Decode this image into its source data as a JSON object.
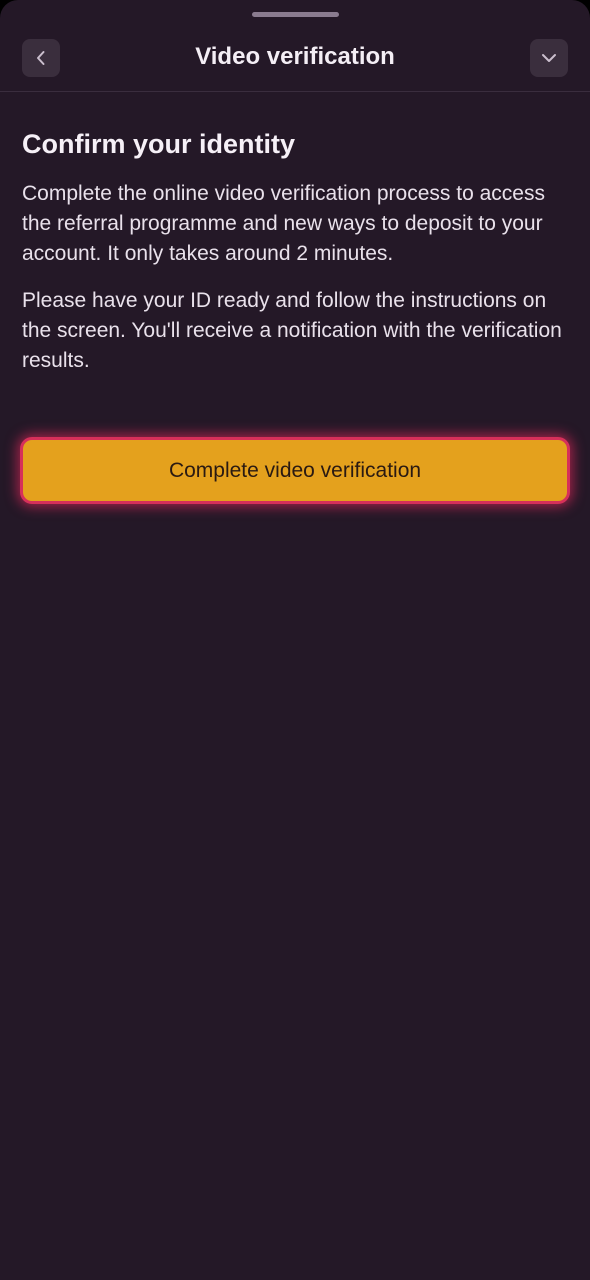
{
  "header": {
    "title": "Video verification",
    "back_icon": "chevron-left-icon",
    "collapse_icon": "chevron-down-icon"
  },
  "main": {
    "heading": "Confirm your identity",
    "paragraph_1": "Complete the online video verification process to access the referral programme and new ways to deposit to your account. It only takes around 2 minutes.",
    "paragraph_2": "Please have your ID ready and follow the instructions on the screen. You'll receive a notification with the verification results.",
    "cta_label": "Complete video verification"
  },
  "colors": {
    "background": "#241827",
    "accent_button": "#e4a11d",
    "focus_ring": "#d6305a"
  }
}
